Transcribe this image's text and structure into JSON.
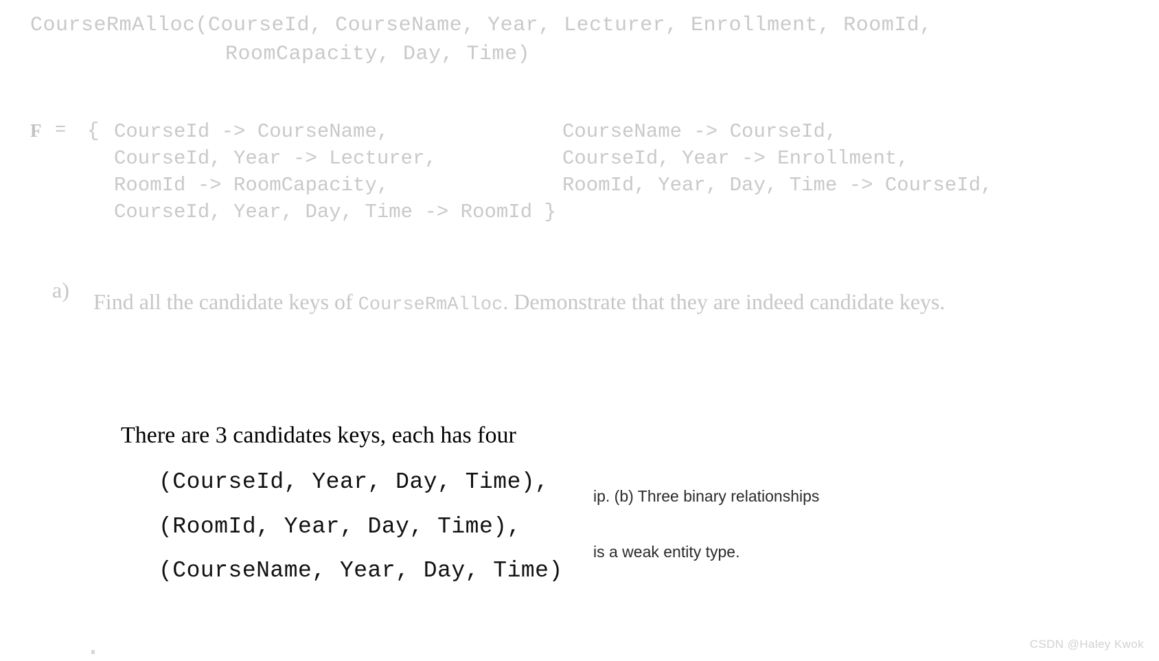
{
  "relation": {
    "line1": "CourseRmAlloc(CourseId, CourseName, Year, Lecturer, Enrollment, RoomId,",
    "line2": "RoomCapacity, Day, Time)"
  },
  "functional_dependencies": {
    "label": "F",
    "equals": "=",
    "open_brace": "{",
    "left_column": "CourseId -> CourseName,\nCourseId, Year -> Lecturer,\nRoomId -> RoomCapacity,\nCourseId, Year, Day, Time -> RoomId }",
    "right_column": "CourseName -> CourseId,\nCourseId, Year -> Enrollment,\nRoomId, Year, Day, Time -> CourseId,",
    "left_items": [
      "CourseId -> CourseName,",
      "CourseId, Year -> Lecturer,",
      "RoomId -> RoomCapacity,",
      "CourseId, Year, Day, Time -> RoomId }"
    ],
    "right_items": [
      "CourseName -> CourseId,",
      "CourseId, Year -> Enrollment,",
      "RoomId, Year, Day, Time -> CourseId,"
    ]
  },
  "question": {
    "marker": "a)",
    "text_before": "Find all the candidate keys of ",
    "relation_name": "CourseRmAlloc",
    "text_after": ".  Demonstrate that they are indeed candidate keys."
  },
  "answer": {
    "heading": "There are 3 candidates keys, each has four",
    "keys": [
      "(CourseId, Year, Day, Time),",
      "(RoomId, Year, Day, Time),",
      "(CourseName, Year, Day, Time)"
    ]
  },
  "scan_fragment": {
    "line1": "ip. (b) Three binary relationships",
    "line2": "is a weak entity type."
  },
  "watermark": "CSDN @Haley Kwok",
  "colors": {
    "faded_mono": "#c9c9c9",
    "faded_serif": "#c6c6c6",
    "answer_text": "#111111",
    "watermark": "#d2d2d2",
    "background": "#ffffff"
  }
}
